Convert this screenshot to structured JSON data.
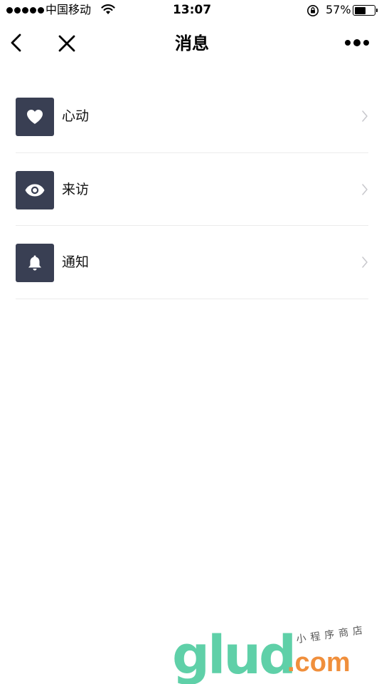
{
  "status_bar": {
    "carrier": "中国移动",
    "time": "13:07",
    "battery_percent": "57%",
    "battery_level": 0.57
  },
  "nav": {
    "title": "消息"
  },
  "items": [
    {
      "label": "心动",
      "icon": "heart-icon"
    },
    {
      "label": "来访",
      "icon": "eye-icon"
    },
    {
      "label": "通知",
      "icon": "bell-icon"
    }
  ],
  "watermark": {
    "brand": "glud",
    "domain": ".com",
    "tagline": "小程序商店"
  },
  "colors": {
    "icon_tile": "#393f53",
    "divider": "#ececec",
    "chevron": "#c7c7cc"
  }
}
